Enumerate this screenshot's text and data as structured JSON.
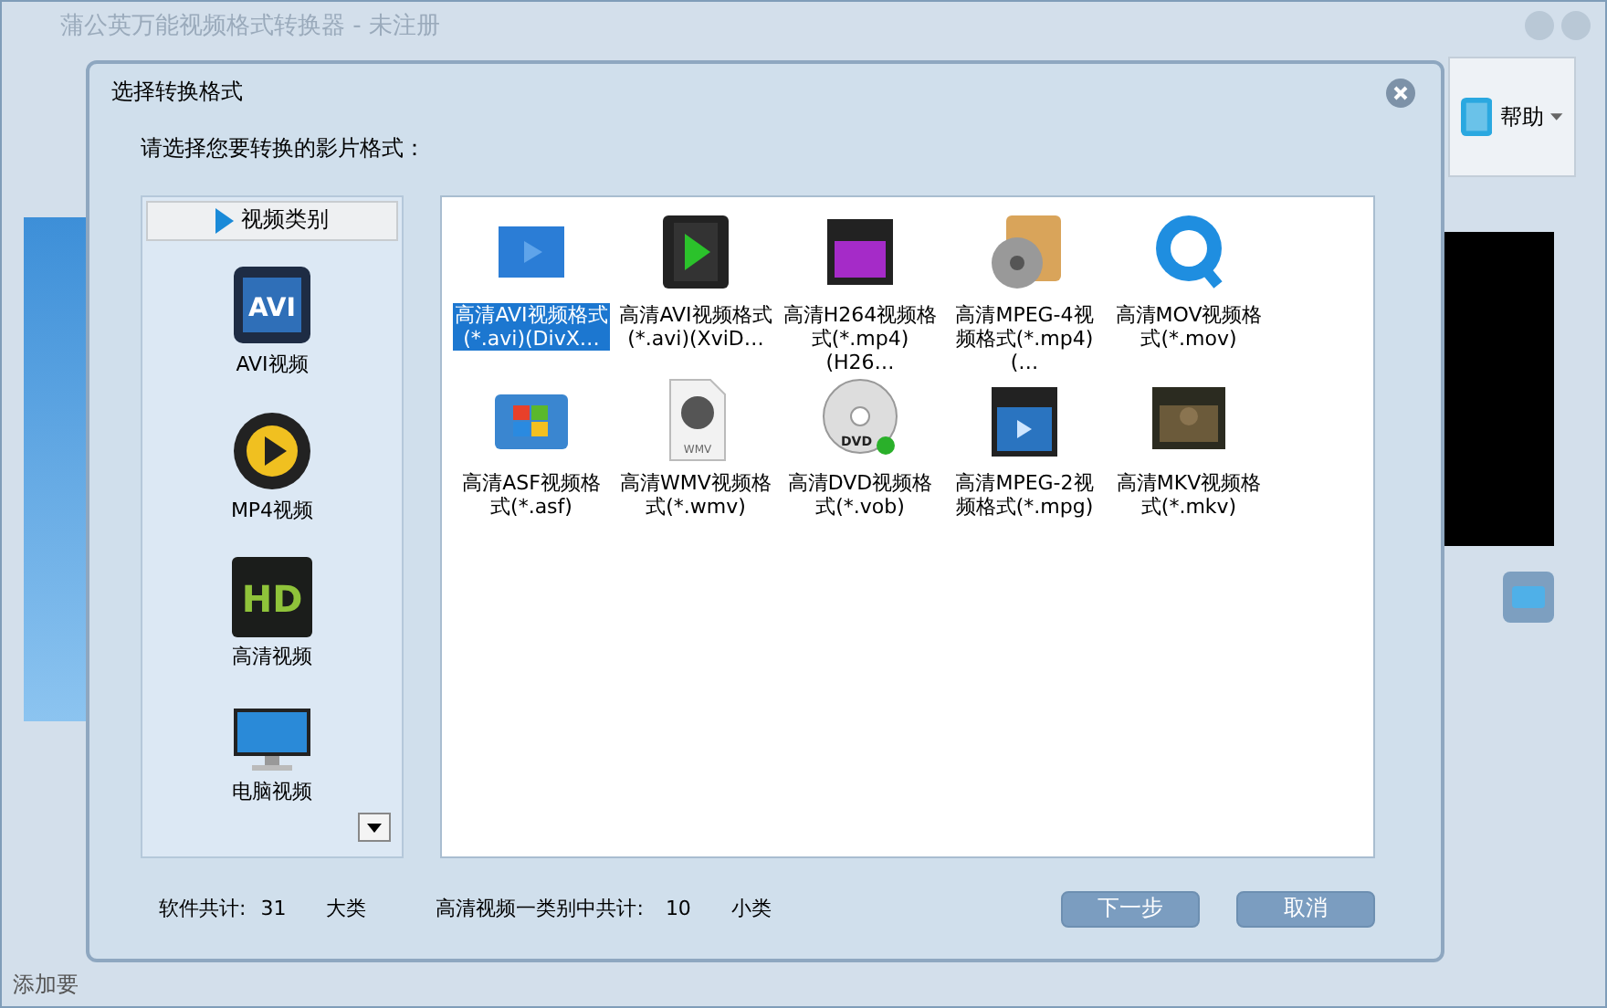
{
  "window": {
    "title": "蒲公英万能视频格式转换器 - 未注册",
    "help_button": "帮助",
    "status_bar": "添加要"
  },
  "dialog": {
    "title": "选择转换格式",
    "prompt": "请选择您要转换的影片格式：",
    "category_header": "视频类别",
    "categories": [
      {
        "label": "AVI视频",
        "kind": "avi",
        "icon_text": "AVI"
      },
      {
        "label": "MP4视频",
        "kind": "mp4"
      },
      {
        "label": "高清视频",
        "kind": "hd",
        "icon_text": "HD"
      },
      {
        "label": "电脑视频",
        "kind": "monitor"
      }
    ],
    "formats": [
      {
        "label": "高清AVI视频格式(*.avi)(DivX…",
        "kind": "blue-film",
        "selected": true
      },
      {
        "label": "高清AVI视频格式(*.avi)(XviD…",
        "kind": "film-play",
        "selected": false
      },
      {
        "label": "高清H264视频格式(*.mp4)(H26…",
        "kind": "clapper-purple",
        "selected": false
      },
      {
        "label": "高清MPEG-4视频格式(*.mp4)(…",
        "kind": "reel-folder",
        "selected": false
      },
      {
        "label": "高清MOV视频格式(*.mov)",
        "kind": "quicktime",
        "selected": false
      },
      {
        "label": "高清ASF视频格式(*.asf)",
        "kind": "windows-folder",
        "selected": false
      },
      {
        "label": "高清WMV视频格式(*.wmv)",
        "kind": "wmv-file",
        "icon_text": "WMV",
        "selected": false
      },
      {
        "label": "高清DVD视频格式(*.vob)",
        "kind": "dvd-disc",
        "icon_text": "DVD",
        "selected": false
      },
      {
        "label": "高清MPEG-2视频格式(*.mpg)",
        "kind": "clapper-blue",
        "selected": false
      },
      {
        "label": "高清MKV视频格式(*.mkv)",
        "kind": "poster",
        "selected": false
      }
    ],
    "footer": {
      "total_label": "软件共计:",
      "total_value": "31",
      "total_unit": "大类",
      "sub_label": "高清视频一类别中共计:",
      "sub_value": "10",
      "sub_unit": "小类"
    },
    "buttons": [
      "下一步",
      "取消"
    ]
  }
}
